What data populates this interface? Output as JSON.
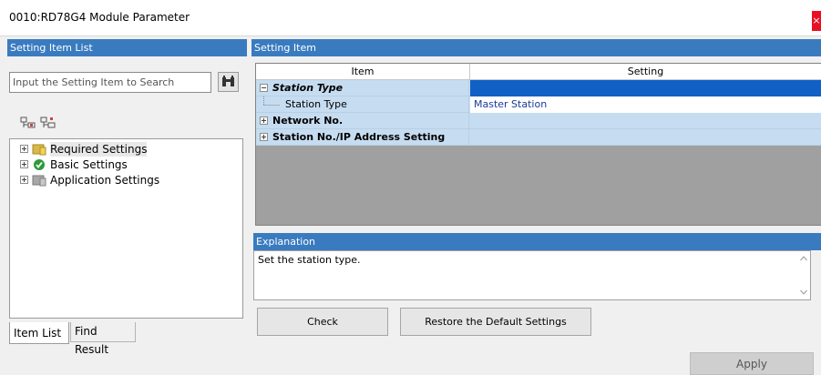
{
  "window": {
    "title": "0010:RD78G4 Module Parameter",
    "close_label": "×"
  },
  "left_panel": {
    "header": "Setting Item List",
    "search_placeholder": "Input the Setting Item to Search",
    "tree": [
      {
        "label": "Required Settings",
        "icon": "folder-required-icon"
      },
      {
        "label": "Basic Settings",
        "icon": "check-circle-icon"
      },
      {
        "label": "Application Settings",
        "icon": "folder-application-icon"
      }
    ],
    "tabs": [
      "Item List",
      "Find Result"
    ]
  },
  "right_panel": {
    "header": "Setting Item",
    "columns": [
      "Item",
      "Setting"
    ],
    "rows": [
      {
        "item": "Station Type",
        "setting": "",
        "type": "group-expanded"
      },
      {
        "item": "Station Type",
        "setting": "Master Station",
        "type": "child"
      },
      {
        "item": "Network No.",
        "setting": "",
        "type": "group-collapsed"
      },
      {
        "item": "Station No./IP Address Setting",
        "setting": "",
        "type": "group-collapsed"
      }
    ],
    "explanation_header": "Explanation",
    "explanation_text": "Set the station type."
  },
  "buttons": {
    "check": "Check",
    "restore": "Restore the Default Settings",
    "apply": "Apply"
  },
  "colors": {
    "panel_header": "#3a7bc0",
    "group_row": "#c6dcf0",
    "selected_cell": "#1060c6",
    "close_button": "#e81123"
  }
}
